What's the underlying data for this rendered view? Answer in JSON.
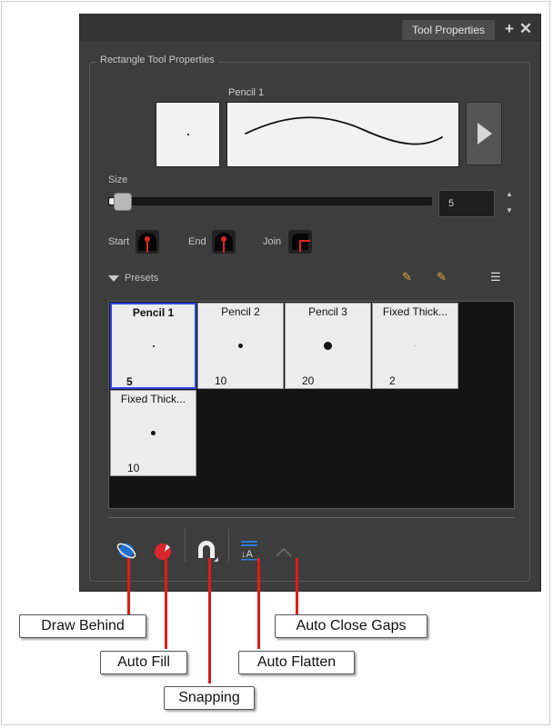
{
  "window": {
    "tab_label": "Tool Properties",
    "add_icon": "plus-icon",
    "close_icon": "close-x-icon"
  },
  "group": {
    "title": "Rectangle Tool Properties",
    "pencil_name": "Pencil 1"
  },
  "size": {
    "label": "Size",
    "value": "5",
    "slider_fraction": 0.02
  },
  "caps": {
    "start_label": "Start",
    "end_label": "End",
    "join_label": "Join"
  },
  "presets": {
    "label": "Presets",
    "toolbar_icons": [
      "new-preset-icon",
      "delete-preset-icon",
      "preset-menu-icon"
    ],
    "items": [
      {
        "name": "Pencil 1",
        "size": "5",
        "selected": true
      },
      {
        "name": "Pencil 2",
        "size": "10",
        "selected": false
      },
      {
        "name": "Pencil 3",
        "size": "20",
        "selected": false
      },
      {
        "name": "Fixed Thick...",
        "size": "2",
        "selected": false
      },
      {
        "name": "Fixed Thick...",
        "size": "10",
        "selected": false
      }
    ]
  },
  "bottom_icons": [
    "draw-behind-icon",
    "auto-fill-icon",
    "snapping-icon",
    "auto-flatten-icon",
    "auto-close-gaps-icon"
  ],
  "callouts": {
    "draw_behind": "Draw Behind",
    "auto_fill": "Auto Fill",
    "snapping": "Snapping",
    "auto_flatten": "Auto Flatten",
    "auto_close_gaps": "Auto Close Gaps"
  },
  "colors": {
    "panel_bg": "#3d3d3d",
    "selection": "#3246e6",
    "leader_red": "#e01b1b",
    "draw_behind_blue": "#1f6fd1",
    "auto_fill_red": "#d8262c"
  }
}
